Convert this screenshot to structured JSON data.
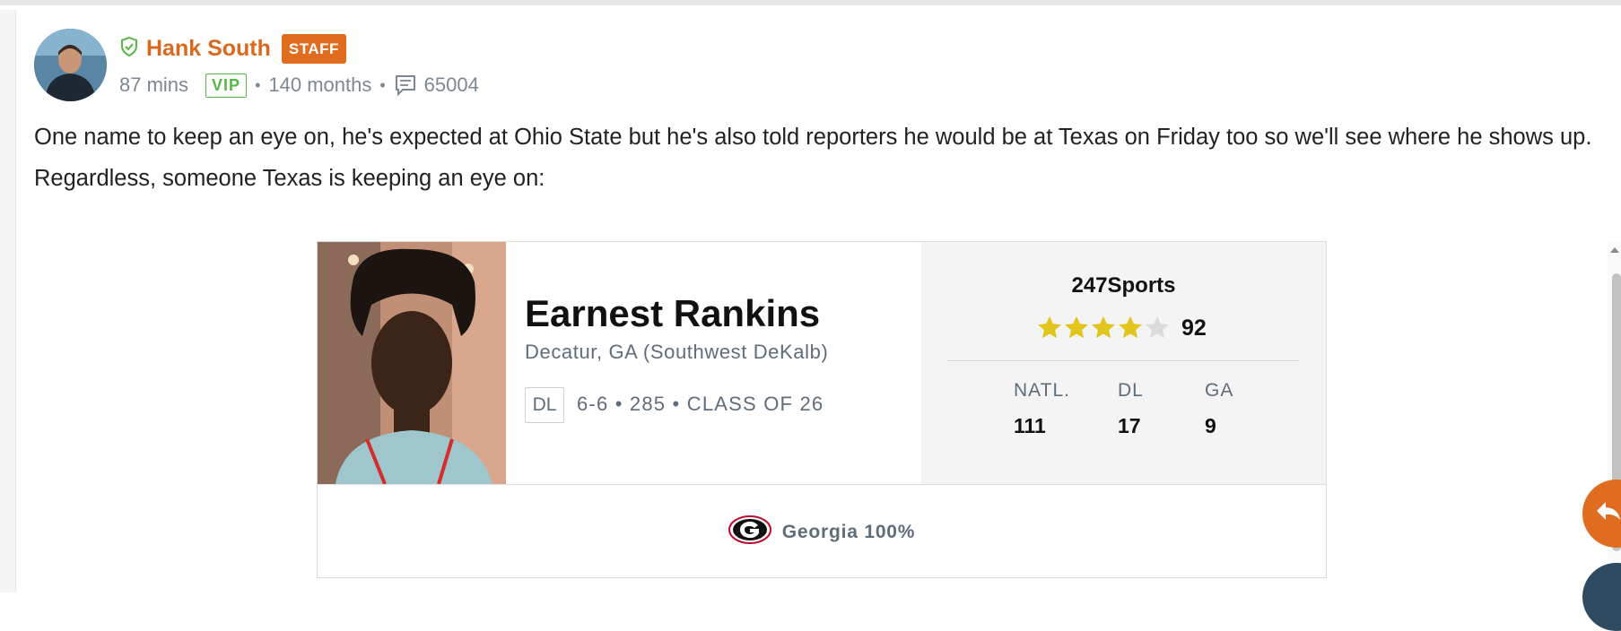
{
  "post": {
    "author": "Hank South",
    "staff_badge": "STAFF",
    "time_ago": "87 mins",
    "vip_badge": "VIP",
    "membership": "140 months",
    "post_count": "65004",
    "text": "One name to keep an eye on, he's expected at Ohio State but he's also told reporters he would be at Texas on Friday too so we'll see where he shows up. Regardless, someone Texas is keeping an eye on:"
  },
  "player_card": {
    "name": "Earnest Rankins",
    "hometown": "Decatur, GA (Southwest DeKalb)",
    "position": "DL",
    "measurables": "6-6 • 285 • CLASS OF 26",
    "rating_service": "247Sports",
    "stars": 4,
    "stars_max": 5,
    "score": "92",
    "rankings": [
      {
        "label": "NATL.",
        "value": "111"
      },
      {
        "label": "DL",
        "value": "17"
      },
      {
        "label": "GA",
        "value": "9"
      }
    ],
    "prediction": "Georgia 100%"
  },
  "colors": {
    "brand_orange": "#e06c1f",
    "vip_green": "#58b548",
    "star_gold": "#e2c51d",
    "star_empty": "#dcdcdc",
    "muted_text": "#5f6d7a"
  },
  "icons": [
    "verified-shield-icon",
    "comment-icon",
    "georgia-logo-icon",
    "reply-icon",
    "scroll-up-icon"
  ]
}
